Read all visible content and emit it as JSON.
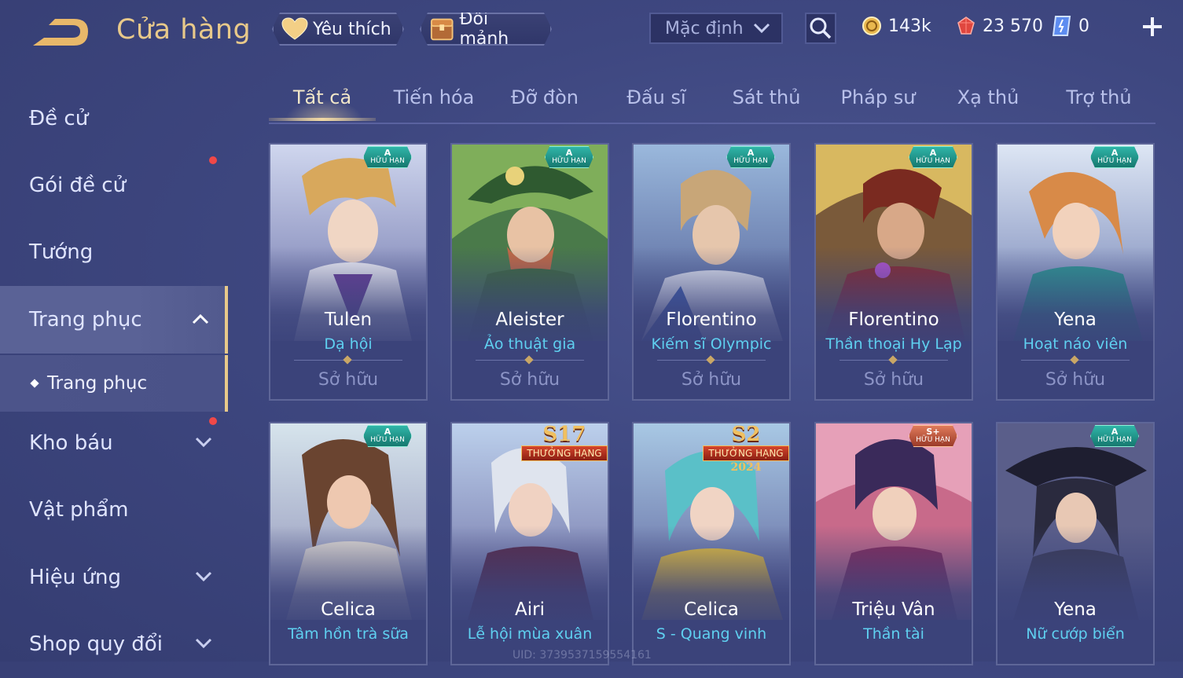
{
  "header": {
    "title": "Cửa hàng",
    "favorite_label": "Yêu thích",
    "exchange_label": "Đổi mảnh",
    "sort_value": "Mặc định"
  },
  "currencies": {
    "gold": "143k",
    "gems": "23 570",
    "tickets": "0"
  },
  "sidebar": {
    "items": [
      {
        "label": "Đề cử"
      },
      {
        "label": "Gói đề cử"
      },
      {
        "label": "Tướng"
      },
      {
        "label": "Trang phục"
      },
      {
        "label": "Trang phục"
      },
      {
        "label": "Kho báu"
      },
      {
        "label": "Vật phẩm"
      },
      {
        "label": "Hiệu ứng"
      },
      {
        "label": "Shop quy đổi"
      }
    ]
  },
  "tabs": [
    "Tất cả",
    "Tiến hóa",
    "Đỡ đòn",
    "Đấu sĩ",
    "Sát thủ",
    "Pháp sư",
    "Xạ thủ",
    "Trợ thủ"
  ],
  "cards": [
    {
      "hero": "Tulen",
      "skin": "Dạ hội",
      "status": "Sở hữu",
      "badge_a": "A",
      "badge_text": "HỮU HẠN"
    },
    {
      "hero": "Aleister",
      "skin": "Ảo thuật gia",
      "status": "Sở hữu",
      "badge_a": "A",
      "badge_text": "HỮU HẠN"
    },
    {
      "hero": "Florentino",
      "skin": "Kiếm sĩ Olympic",
      "status": "Sở hữu",
      "badge_a": "A",
      "badge_text": "HỮU HẠN"
    },
    {
      "hero": "Florentino",
      "skin": "Thần thoại Hy Lạp",
      "status": "Sở hữu",
      "badge_a": "A",
      "badge_text": "HỮU HẠN"
    },
    {
      "hero": "Yena",
      "skin": "Hoạt náo viên",
      "status": "Sở hữu",
      "badge_a": "A",
      "badge_text": "HỮU HẠN"
    },
    {
      "hero": "Celica",
      "skin": "Tâm hồn trà sữa",
      "badge_a": "A",
      "badge_text": "HỮU HẠN"
    },
    {
      "hero": "Airi",
      "skin": "Lễ hội mùa xuân",
      "season": "S17",
      "ribbon": "THƯỞNG HẠNG"
    },
    {
      "hero": "Celica",
      "skin": "S - Quang vinh",
      "season": "S2",
      "ribbon": "THƯỞNG HẠNG",
      "year": "2024"
    },
    {
      "hero": "Triệu Vân",
      "skin": "Thần tài",
      "badge_a": "S+",
      "badge_text": "HỮU HẠN"
    },
    {
      "hero": "Yena",
      "skin": "Nữ cướp biển",
      "badge_a": "A",
      "badge_text": "HỮU HẠN"
    }
  ],
  "uid_text": "UID: 3739537159554161",
  "colors": {
    "background": "#3e4780",
    "accent_gold": "#e8c98a",
    "skin_name": "#5fd0f0",
    "notification": "#f04848"
  }
}
